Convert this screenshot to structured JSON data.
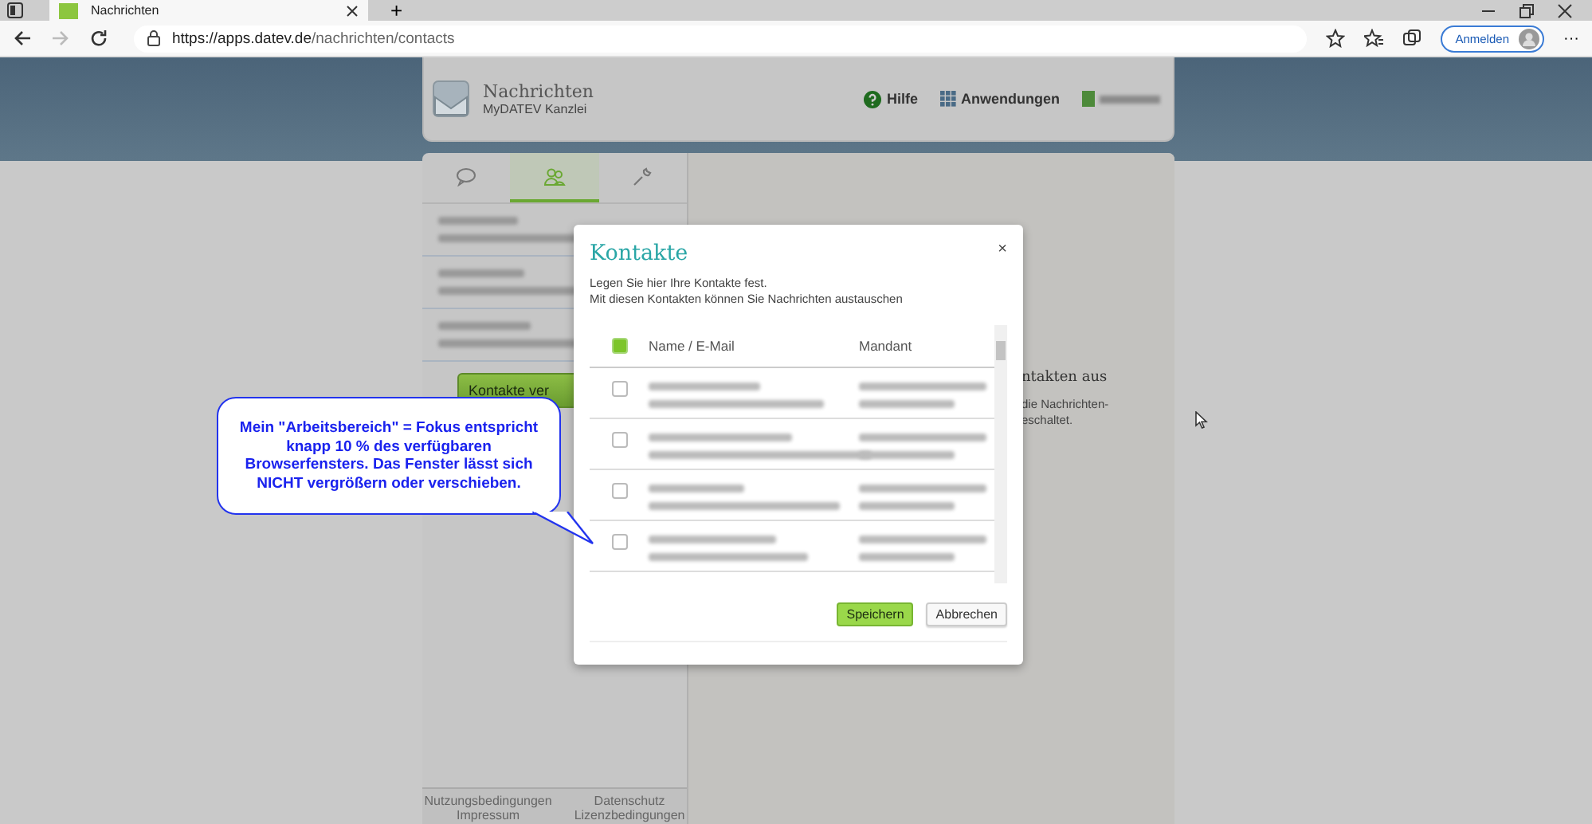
{
  "browser": {
    "tab_title": "Nachrichten",
    "new_tab": "+",
    "url_host": "https://apps.datev.de",
    "url_path": "/nachrichten/contacts",
    "sign_in": "Anmelden",
    "more": "···"
  },
  "app": {
    "title": "Nachrichten",
    "subtitle": "MyDATEV Kanzlei",
    "help": "Hilfe",
    "apps": "Anwendungen"
  },
  "sidebar": {
    "tabs": [
      {
        "kind": "chat",
        "selected": false
      },
      {
        "kind": "contacts",
        "selected": true
      },
      {
        "kind": "settings",
        "selected": false
      }
    ],
    "contacts": [
      {
        "kind": "blurred"
      },
      {
        "kind": "blurred"
      },
      {
        "kind": "blurred"
      }
    ],
    "manage_button": "Kontakte ver",
    "footer_links": [
      "Nutzungsbedingungen",
      "Datenschutz",
      "Impressum",
      "Lizenzbedingungen"
    ]
  },
  "main": {
    "heading": "ntakten aus",
    "text_lines": [
      "die Nachrichten-",
      "eschaltet."
    ]
  },
  "dialog": {
    "title": "Kontakte",
    "close": "×",
    "intro_lines": [
      "Legen Sie hier Ihre Kontakte fest.",
      "Mit diesen Kontakten können Sie Nachrichten austauschen"
    ],
    "select_all": {
      "checked": true
    },
    "columns": [
      "Name / E-Mail",
      "Mandant"
    ],
    "rows": [
      {
        "kind": "blurred",
        "checked": false
      },
      {
        "kind": "blurred",
        "checked": false
      },
      {
        "kind": "blurred",
        "checked": false
      },
      {
        "kind": "blurred",
        "checked": false
      }
    ],
    "buttons": [
      {
        "kind": "primary",
        "label": "Speichern"
      },
      {
        "kind": "secondary",
        "label": "Abbrechen"
      }
    ]
  },
  "callout": {
    "text": "Mein \"Arbeitsbereich\" = Fokus entspricht knapp 10 % des verfügbaren Browserfensters. Das Fenster lässt sich NICHT vergrößern oder verschieben."
  }
}
